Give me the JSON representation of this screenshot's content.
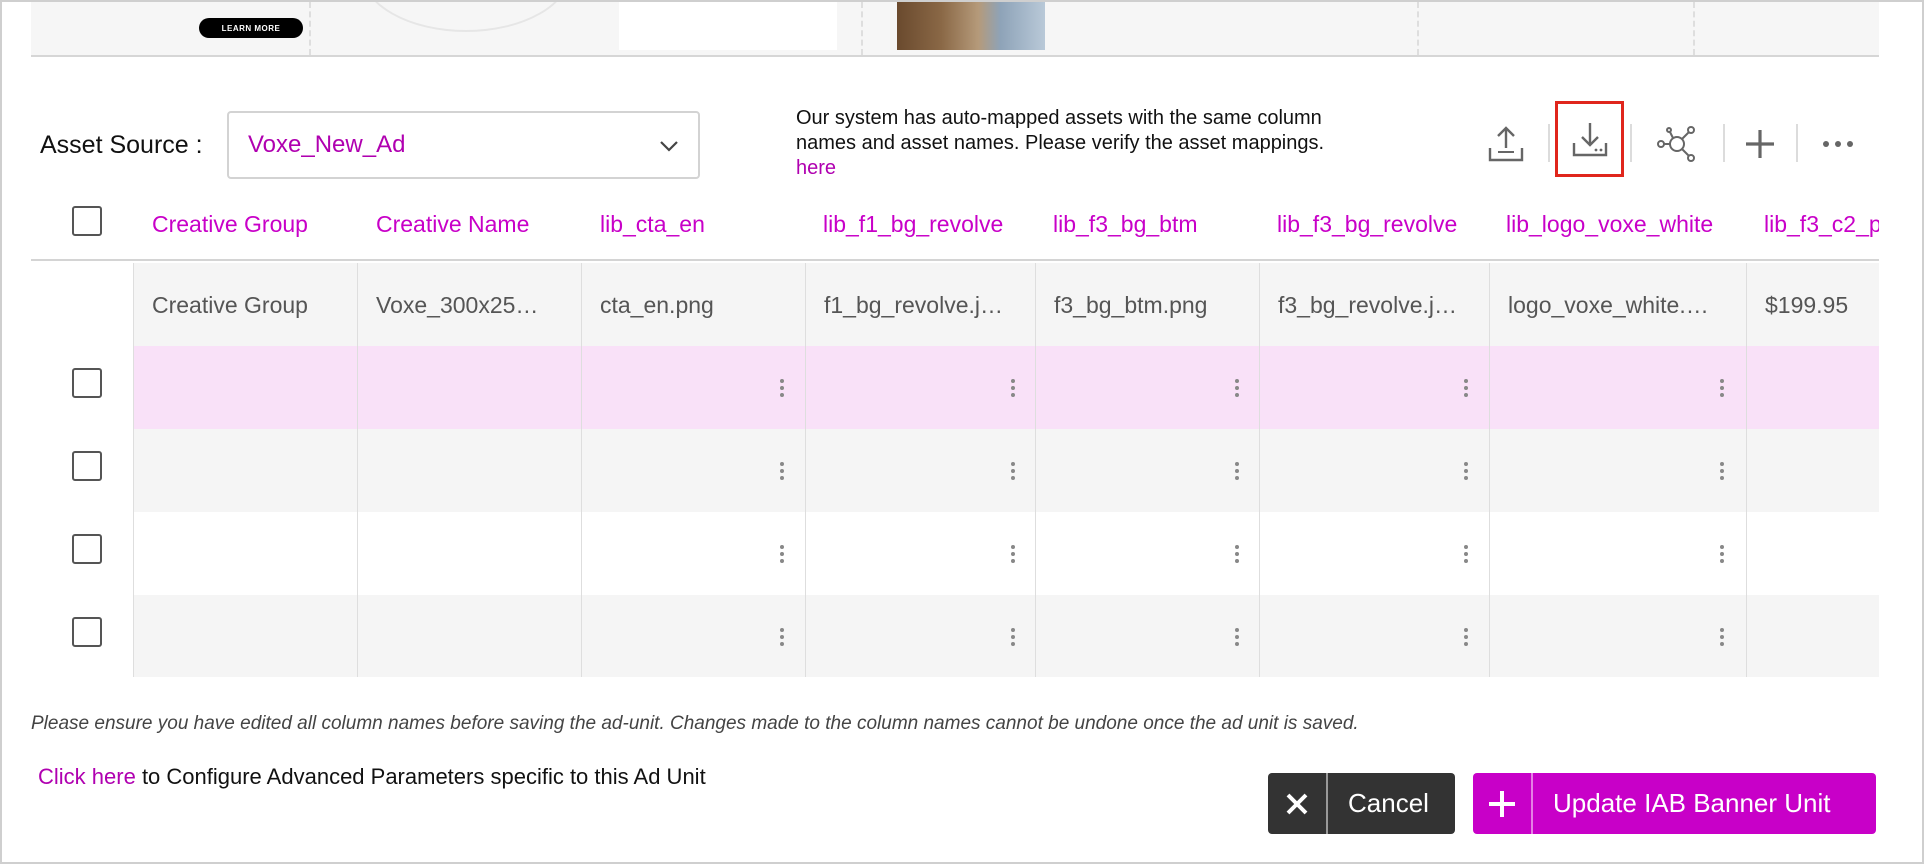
{
  "preview": {
    "cta_label": "LEARN MORE"
  },
  "asset_source": {
    "label": "Asset Source :",
    "selected": "Voxe_New_Ad"
  },
  "info": {
    "text": "Our system has auto-mapped assets with the same column names and asset names. Please verify the asset mappings.",
    "link": "here"
  },
  "toolbar": {
    "items": [
      {
        "icon": "upload-icon"
      },
      {
        "icon": "download-icon",
        "highlighted": true
      },
      {
        "icon": "network-icon"
      },
      {
        "icon": "plus-icon"
      },
      {
        "icon": "more-horizontal-icon"
      }
    ]
  },
  "table": {
    "columns": [
      "Creative Group",
      "Creative Name",
      "lib_cta_en",
      "lib_f1_bg_revolve",
      "lib_f3_bg_btm",
      "lib_f3_bg_revolve",
      "lib_logo_voxe_white",
      "lib_f3_c2_p"
    ],
    "mapped_row": [
      "Creative Group",
      "Voxe_300x25…",
      "cta_en.png",
      "f1_bg_revolve.j…",
      "f3_bg_btm.png",
      "f3_bg_revolve.j…",
      "logo_voxe_white.…",
      "$199.95"
    ],
    "empty_rows": 4,
    "row_colors": [
      "#f9e1f8",
      "#f5f5f5",
      "#ffffff",
      "#f5f5f5"
    ]
  },
  "note": "Please ensure you have edited all column names before saving the ad-unit. Changes made to the column names cannot be undone once the ad unit is saved.",
  "advanced": {
    "link": "Click here",
    "text": "to Configure Advanced Parameters specific to this Ad Unit"
  },
  "buttons": {
    "cancel": "Cancel",
    "update": "Update IAB Banner Unit"
  },
  "colors": {
    "accent": "#c800c8",
    "highlight_border": "#e0261c",
    "cancel_bg": "#333333"
  }
}
